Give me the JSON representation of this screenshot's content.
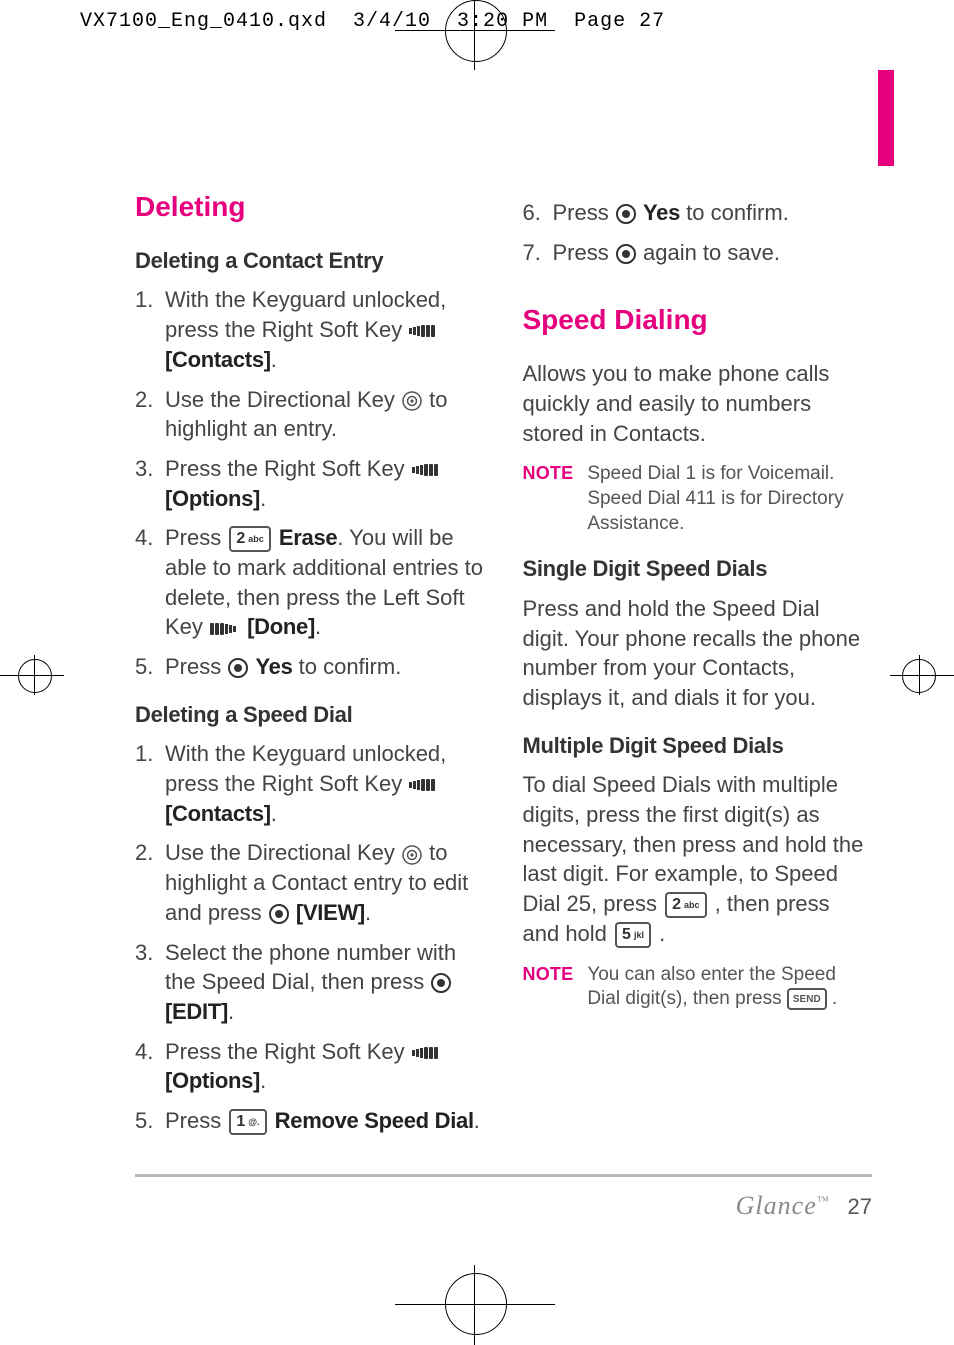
{
  "print_header": "VX7100_Eng_0410.qxd  3/4/10  3:20 PM  Page 27",
  "page_number": "27",
  "brand": "Glance",
  "brand_mark": "™",
  "left": {
    "title": "Deleting",
    "sub1": "Deleting a Contact Entry",
    "steps1": {
      "s1_a": "With the Keyguard unlocked, press the Right Soft Key ",
      "s1_b": "[Contacts]",
      "s1_c": ".",
      "s2_a": "Use the Directional Key ",
      "s2_b": " to highlight an entry.",
      "s3_a": "Press the Right Soft Key ",
      "s3_b": "[Options]",
      "s3_c": ".",
      "s4_a": "Press ",
      "s4_key_num": "2",
      "s4_key_sub": "abc",
      "s4_b": "Erase",
      "s4_c": ". You will be able to mark additional entries to delete, then press the Left Soft Key ",
      "s4_d": "[Done]",
      "s4_e": ".",
      "s5_a": "Press ",
      "s5_b": "Yes",
      "s5_c": " to confirm."
    },
    "sub2": "Deleting a Speed Dial",
    "steps2": {
      "s1_a": "With the Keyguard unlocked, press the Right Soft Key ",
      "s1_b": "[Contacts]",
      "s1_c": ".",
      "s2_a": "Use the Directional Key ",
      "s2_b": " to highlight a Contact entry to edit and press ",
      "s2_c": "[VIEW]",
      "s2_d": ".",
      "s3_a": "Select the phone number with the Speed Dial, then press ",
      "s3_b": "[EDIT]",
      "s3_c": ".",
      "s4_a": "Press the Right Soft Key ",
      "s4_b": "[Options]",
      "s4_c": ".",
      "s5_a": "Press ",
      "s5_key_num": "1",
      "s5_key_sub": "@.",
      "s5_b": "Remove Speed Dial",
      "s5_c": "."
    }
  },
  "right": {
    "cont": {
      "s6_a": "Press ",
      "s6_b": "Yes",
      "s6_c": " to confirm.",
      "s7_a": "Press ",
      "s7_b": " again to save."
    },
    "title": "Speed Dialing",
    "intro": "Allows you to make phone calls quickly and easily to numbers stored in Contacts.",
    "note1_label": "NOTE",
    "note1_text": "Speed Dial 1 is for Voicemail. Speed Dial 411 is for Directory Assistance.",
    "sub1": "Single Digit Speed Dials",
    "para1": "Press and hold the Speed Dial digit. Your phone recalls the phone number from your Contacts, displays it, and dials it for you.",
    "sub2": "Multiple Digit Speed Dials",
    "para2_a": "To dial Speed Dials with multiple digits, press the first digit(s) as necessary, then press and hold the last digit. For example, to Speed Dial 25, press ",
    "para2_key1_num": "2",
    "para2_key1_sub": "abc",
    "para2_b": " , then press and hold ",
    "para2_key2_num": "5",
    "para2_key2_sub": "jkl",
    "para2_c": " .",
    "note2_label": "NOTE",
    "note2_text_a": "You can also enter the Speed Dial digit(s), then press ",
    "note2_send": "SEND",
    "note2_text_b": " ."
  }
}
